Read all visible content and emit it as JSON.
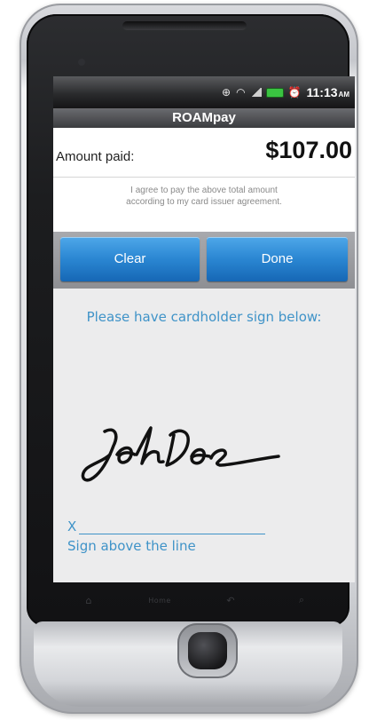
{
  "status_bar": {
    "time": "11:13",
    "ampm": "AM",
    "icons": [
      "gps-icon",
      "wifi-icon",
      "signal-icon",
      "battery-icon",
      "alarm-icon"
    ]
  },
  "app": {
    "title": "ROAMpay"
  },
  "payment": {
    "amount_label": "Amount paid:",
    "amount_value": "$107.00",
    "agreement_line1": "I agree to pay the above total amount",
    "agreement_line2": "according to my card issuer agreement."
  },
  "actions": {
    "clear_label": "Clear",
    "done_label": "Done"
  },
  "signature_area": {
    "prompt": "Please have cardholder sign below:",
    "x_mark": "X",
    "caption": "Sign above the line"
  },
  "hardware_keys": {
    "home_label": "Home",
    "icons": [
      "home-icon",
      "menu-icon",
      "back-icon",
      "search-icon"
    ]
  },
  "colors": {
    "accent_text": "#3f93c8",
    "button_blue": "#2a86d2",
    "battery_green": "#3ac341"
  }
}
